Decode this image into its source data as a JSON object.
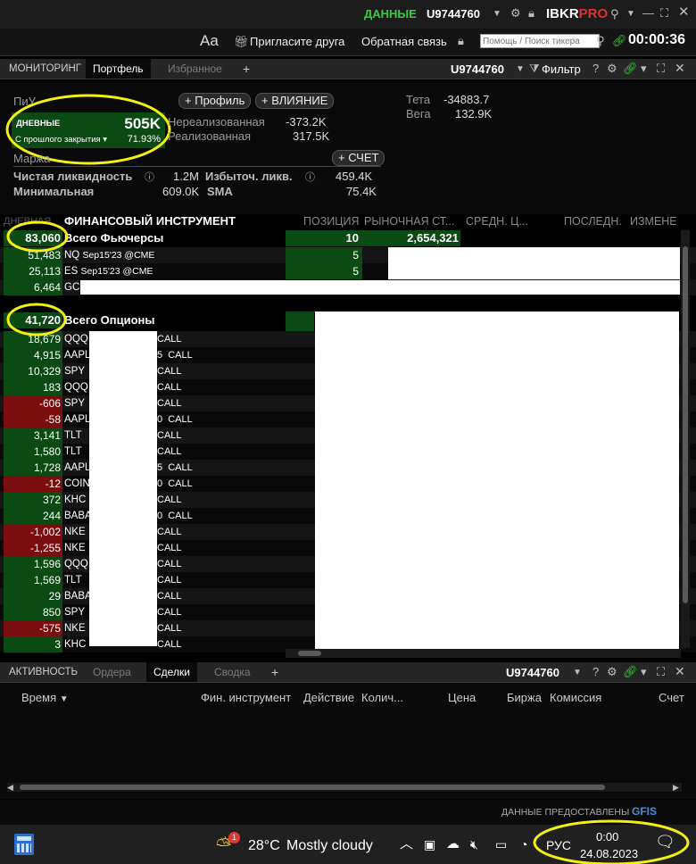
{
  "topbar": {
    "data_label": "ДАННЫЕ",
    "account": "U9744760",
    "brand_ibkr": "IBKR",
    "brand_pro": "PRO"
  },
  "toolbar": {
    "font_btn": "Aa",
    "invite": "Пригласите друга",
    "feedback": "Обратная связь",
    "search_placeholder": "Помощь / Поиск тикера",
    "clock": "00:00:36"
  },
  "monitor_panel": {
    "tabs": [
      "МОНИТОРИНГ",
      "Портфель",
      "Избранное",
      "+"
    ],
    "account": "U9744760",
    "filter": "Фильтр"
  },
  "summary": {
    "pnl_label": "ПиУ",
    "profile_btn": "Профиль",
    "influence_btn": "ВЛИЯНИЕ",
    "daily_label": "ДНЕВНЫЕ",
    "daily_value": "505K",
    "since_close_label": "С прошлого закрытия",
    "since_close_pct": "71.93%",
    "unrealized_label": "Нереализованная",
    "unrealized_value": "-373.2K",
    "realized_label": "Реализованная",
    "realized_value": "317.5K",
    "theta_label": "Тета",
    "theta_value": "-34883.7",
    "vega_label": "Вега",
    "vega_value": "132.9K",
    "margin_label": "Маржа",
    "account_btn": "СЧЕТ",
    "net_liq_label": "Чистая ликвидность",
    "net_liq_value": "1.2M",
    "excess_liq_label": "Избыточ. ликв.",
    "excess_liq_value": "459.4K",
    "min_label": "Минимальная",
    "min_value": "609.0K",
    "sma_label": "SMA",
    "sma_value": "75.4K"
  },
  "columns": [
    "ДНЕВНАЯ",
    "ФИНАНСОВЫЙ ИНСТРУМЕНТ",
    "ПОЗИЦИЯ",
    "РЫНОЧНАЯ СТ...",
    "СРЕДН. Ц...",
    "ПОСЛЕДН.",
    "ИЗМЕНЕ"
  ],
  "futures": {
    "total_pnl": "83,060",
    "total_label": "Всего Фьючерсы",
    "total_position": "10",
    "total_market": "2,654,321",
    "rows": [
      {
        "pnl": "51,483",
        "sym": "NQ",
        "desc": "Sep15'23 @CME",
        "pos": "5",
        "color": "green"
      },
      {
        "pnl": "25,113",
        "sym": "ES",
        "desc": "Sep15'23 @CME",
        "pos": "5",
        "color": "green"
      },
      {
        "pnl": "6,464",
        "sym": "GC",
        "desc": "",
        "pos": "",
        "color": "green"
      }
    ]
  },
  "options": {
    "total_pnl": "41,720",
    "total_label": "Всего Опционы",
    "rows": [
      {
        "pnl": "18,679",
        "sym": "QQQ",
        "type": "CALL",
        "color": "green"
      },
      {
        "pnl": "4,915",
        "sym": "AAPL",
        "type": "5  CALL",
        "color": "green"
      },
      {
        "pnl": "10,329",
        "sym": "SPY",
        "type": "CALL",
        "color": "green"
      },
      {
        "pnl": "183",
        "sym": "QQQ",
        "type": "CALL",
        "color": "green"
      },
      {
        "pnl": "-606",
        "sym": "SPY",
        "type": "CALL",
        "color": "red"
      },
      {
        "pnl": "-58",
        "sym": "AAPL",
        "type": "0  CALL",
        "color": "red"
      },
      {
        "pnl": "3,141",
        "sym": "TLT",
        "type": "CALL",
        "color": "green"
      },
      {
        "pnl": "1,580",
        "sym": "TLT",
        "type": "CALL",
        "color": "green"
      },
      {
        "pnl": "1,728",
        "sym": "AAPL",
        "type": "5  CALL",
        "color": "green"
      },
      {
        "pnl": "-12",
        "sym": "COIN",
        "type": "0  CALL",
        "color": "red"
      },
      {
        "pnl": "372",
        "sym": "KHC",
        "type": "CALL",
        "color": "green"
      },
      {
        "pnl": "244",
        "sym": "BABA",
        "type": "0  CALL",
        "color": "green"
      },
      {
        "pnl": "-1,002",
        "sym": "NKE",
        "type": "CALL",
        "color": "red"
      },
      {
        "pnl": "-1,255",
        "sym": "NKE",
        "type": "CALL",
        "color": "red"
      },
      {
        "pnl": "1,596",
        "sym": "QQQ",
        "type": "CALL",
        "color": "green"
      },
      {
        "pnl": "1,569",
        "sym": "TLT",
        "type": "CALL",
        "color": "green"
      },
      {
        "pnl": "29",
        "sym": "BABA",
        "type": "CALL",
        "color": "green"
      },
      {
        "pnl": "850",
        "sym": "SPY",
        "type": "CALL",
        "color": "green"
      },
      {
        "pnl": "-575",
        "sym": "NKE",
        "type": "CALL",
        "color": "red"
      },
      {
        "pnl": "3",
        "sym": "KHC",
        "type": "CALL",
        "color": "green"
      }
    ]
  },
  "activity_panel": {
    "tabs": [
      "АКТИВНОСТЬ",
      "Ордера",
      "Сделки",
      "Сводка",
      "+"
    ],
    "account": "U9744760",
    "columns": [
      "Время",
      "Фин. инструмент",
      "Действие",
      "Колич...",
      "Цена",
      "Биржа",
      "Комиссия",
      "Счет"
    ]
  },
  "footer": {
    "data_provided": "ДАННЫЕ ПРЕДОСТАВЛЕНЫ",
    "gfis": "GFIS"
  },
  "taskbar": {
    "badge": "1",
    "temp": "28°C",
    "weather": "Mostly cloudy",
    "lang": "РУС",
    "time": "0:00",
    "date": "24.08.2023"
  }
}
